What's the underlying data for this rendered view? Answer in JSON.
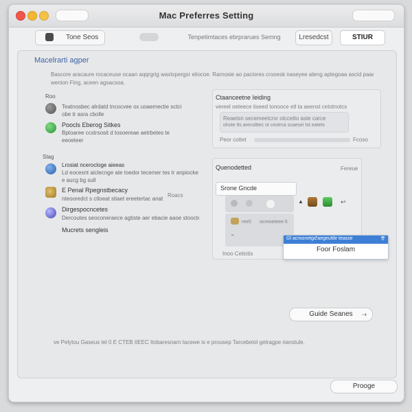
{
  "window": {
    "title": "Mac Preferres Setting"
  },
  "toolbar": {
    "left_label": "Tone Seos",
    "center_label": "Tenpetimtaces ebrprarues Semng",
    "right_label": "Lresedcst",
    "primary_label": "STIUR"
  },
  "panel": {
    "heading": "Macelrarti agper",
    "intro_line1": "Bascore aracaure rocaceuse ocaan aqqrgrig waxtxpergsr eliocoe. Rarnosie ao paciores crooesk naseyee ateng aptegoaa ascid paaeacr elatt suteay",
    "intro_line2": "wenion Fing, aceen agsacsoa."
  },
  "left_groups": [
    {
      "label": "Roo",
      "items": [
        {
          "name": "",
          "desc": "Teatnosbec alrdatd tncocvee ox uoaemectie sctci obe tr asra cbolle"
        },
        {
          "name": "Poocls Eberog Sitkes",
          "desc": "Bptoaree ccstrsosit d tosoereae aetrbetes te eeoeteer"
        }
      ]
    },
    {
      "label": "Stag",
      "items": [
        {
          "name": "Lrosiat ncerocloge aieeas",
          "desc": "Ld eocesnt aiclecnge ate toedor tecemer tes tr anpiocke e aucg bg sull"
        },
        {
          "name": "E Penal Rpegnstbecacy",
          "desc": "nteooredct s ctloeat stiaet ereetertac anat"
        },
        {
          "name": "Dirgespocncetes",
          "desc": "Dercoutes seoconeraece agtiste aer ebacie aaoe stoocteioe dorrcelseecocs"
        }
      ],
      "footer": "Mucrets sengleis"
    }
  ],
  "right_card1": {
    "title": "Ctaanceetne Ieiding",
    "subtitle": "vereel oeteece tiseed tonooce etl ta aeenst cetotnotcs",
    "line1": "Reaetsn secemeetcrsr otccetto aste carce",
    "line2": "ohote tts arecolttec ot ceotrca scaesei tst eatets",
    "footer_left": "Peor cottet",
    "footer_right": "Fcoso"
  },
  "right_card2": {
    "title": "Quenodetted",
    "top_right": "Fereue",
    "dropdown_label": "Srone Gncde",
    "bottom_label": "Inoo Cetiotis",
    "aux_label": "Roacs",
    "popup_header": "Gl acroonetgd'aegeuttle teasse",
    "popup_item": "Foor Foslam",
    "aux_text1": "ree5",
    "aux_text2": "ocreoeteee lt"
  },
  "guide_button": "Guide Seanes",
  "footer_note": "ve Pelytou Gaseus tel 0 E CTEB IIEEC Itobaresnam tacewe is e prousep Tarcebeiol getragpe rianstule.",
  "bottom_button": "Prooge",
  "colors": {
    "accent_blue": "#3d7fd6",
    "heading_blue": "#3d62a8",
    "red": "#f0564a",
    "yellow": "#f2b630",
    "green": "#3fb04e"
  }
}
